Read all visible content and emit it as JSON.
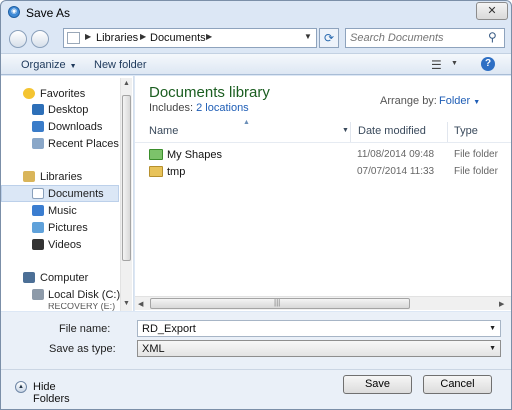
{
  "window": {
    "title": "Save As",
    "close_glyph": "✕"
  },
  "address_bar": {
    "segments": [
      "Libraries",
      "Documents"
    ],
    "search_placeholder": "Search Documents"
  },
  "toolbar": {
    "organize_label": "Organize",
    "new_folder_label": "New folder"
  },
  "nav_pane": {
    "items": [
      {
        "label": "Favorites",
        "icon": "star-icon"
      },
      {
        "label": "Desktop",
        "icon": "desktop-icon"
      },
      {
        "label": "Downloads",
        "icon": "downloads-icon"
      },
      {
        "label": "Recent Places",
        "icon": "recent-places-icon"
      },
      {
        "label": "Libraries",
        "icon": "libraries-icon"
      },
      {
        "label": "Documents",
        "icon": "documents-icon",
        "selected": true
      },
      {
        "label": "Music",
        "icon": "music-icon"
      },
      {
        "label": "Pictures",
        "icon": "pictures-icon"
      },
      {
        "label": "Videos",
        "icon": "videos-icon"
      },
      {
        "label": "Computer",
        "icon": "computer-icon"
      },
      {
        "label": "Local Disk (C:)",
        "icon": "local-disk-icon"
      },
      {
        "label": "RECOVERY (E:)",
        "icon": "drive-icon"
      }
    ]
  },
  "content": {
    "library_title": "Documents library",
    "includes_label": "Includes:",
    "includes_link": "2 locations",
    "arrange_label": "Arrange by:",
    "arrange_value": "Folder",
    "columns": [
      "Name",
      "Date modified",
      "Type"
    ],
    "rows": [
      {
        "name": "My Shapes",
        "date": "11/08/2014 09:48",
        "type": "File folder",
        "icon": "shapes-folder-icon"
      },
      {
        "name": "tmp",
        "date": "07/07/2014 11:33",
        "type": "File folder",
        "icon": "folder-icon"
      }
    ]
  },
  "form": {
    "file_name_label": "File name:",
    "file_name_value": "RD_Export",
    "save_type_label": "Save as type:",
    "save_type_value": "XML"
  },
  "footer": {
    "hide_folders_label": "Hide Folders",
    "save_label": "Save",
    "cancel_label": "Cancel"
  },
  "colors": {
    "accent": "#1f5eb6",
    "library_title": "#1b5e20"
  }
}
